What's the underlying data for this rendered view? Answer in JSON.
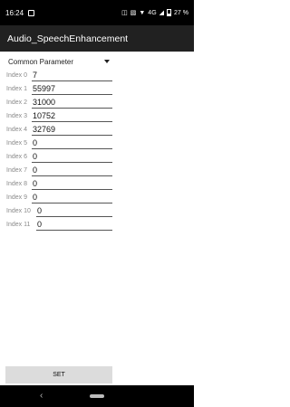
{
  "status_bar": {
    "time": "16:24",
    "battery": "27 %",
    "network": "4G",
    "icons": [
      "image-notification-icon",
      "headphones-icon",
      "vibrate-icon",
      "wifi-icon",
      "signal-icon",
      "battery-icon"
    ]
  },
  "app_bar": {
    "title": "Audio_SpeechEnhancement"
  },
  "spinner": {
    "selected": "Common Parameter"
  },
  "rows": [
    {
      "label": "Index 0",
      "value": "7"
    },
    {
      "label": "Index 1",
      "value": "55997"
    },
    {
      "label": "Index 2",
      "value": "31000"
    },
    {
      "label": "Index 3",
      "value": "10752"
    },
    {
      "label": "Index 4",
      "value": "32769"
    },
    {
      "label": "Index 5",
      "value": "0"
    },
    {
      "label": "Index 6",
      "value": "0"
    },
    {
      "label": "Index 7",
      "value": "0"
    },
    {
      "label": "Index 8",
      "value": "0"
    },
    {
      "label": "Index 9",
      "value": "0"
    },
    {
      "label": "Index 10",
      "value": "0"
    },
    {
      "label": "Index 11",
      "value": "0"
    }
  ],
  "set_button": {
    "label": "SET"
  },
  "colors": {
    "app_bar": "#212121",
    "status_bar": "#000000",
    "button": "#dcdcdc"
  }
}
